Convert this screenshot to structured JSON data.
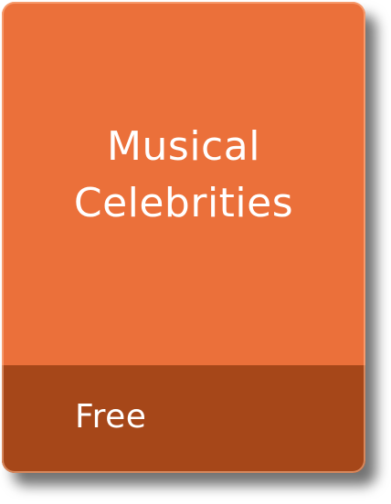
{
  "card": {
    "title": "Musical Celebrities",
    "price_label": "Free"
  },
  "colors": {
    "card_background": "#EB703A",
    "footer_background": "#A64719",
    "text": "#FFFFFF"
  }
}
